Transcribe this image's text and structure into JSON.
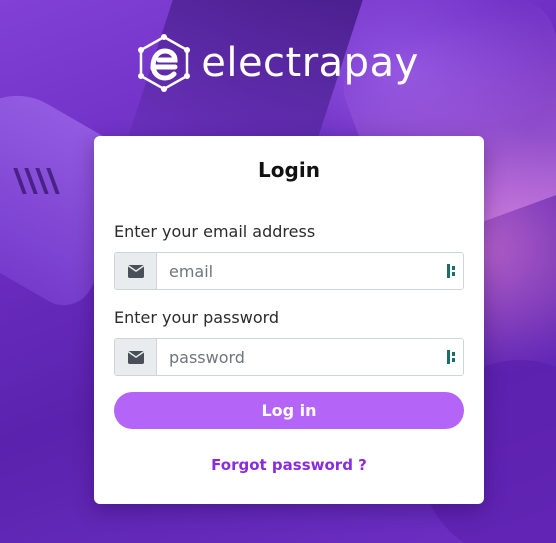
{
  "brand": {
    "name": "electrapay",
    "logo_icon": "electrapay-hexagon-logo"
  },
  "login": {
    "title": "Login",
    "email_label": "Enter your email address",
    "email_placeholder": "email",
    "email_value": "",
    "email_icon": "envelope-icon",
    "password_label": "Enter your password",
    "password_placeholder": "password",
    "password_value": "",
    "password_icon": "envelope-icon",
    "autofill_icon": "password-manager-icon",
    "submit_label": "Log in",
    "forgot_label": "Forgot password ?"
  },
  "colors": {
    "accent_button": "#b464f7",
    "link": "#8a2be2",
    "background": "#6b2fb8"
  }
}
